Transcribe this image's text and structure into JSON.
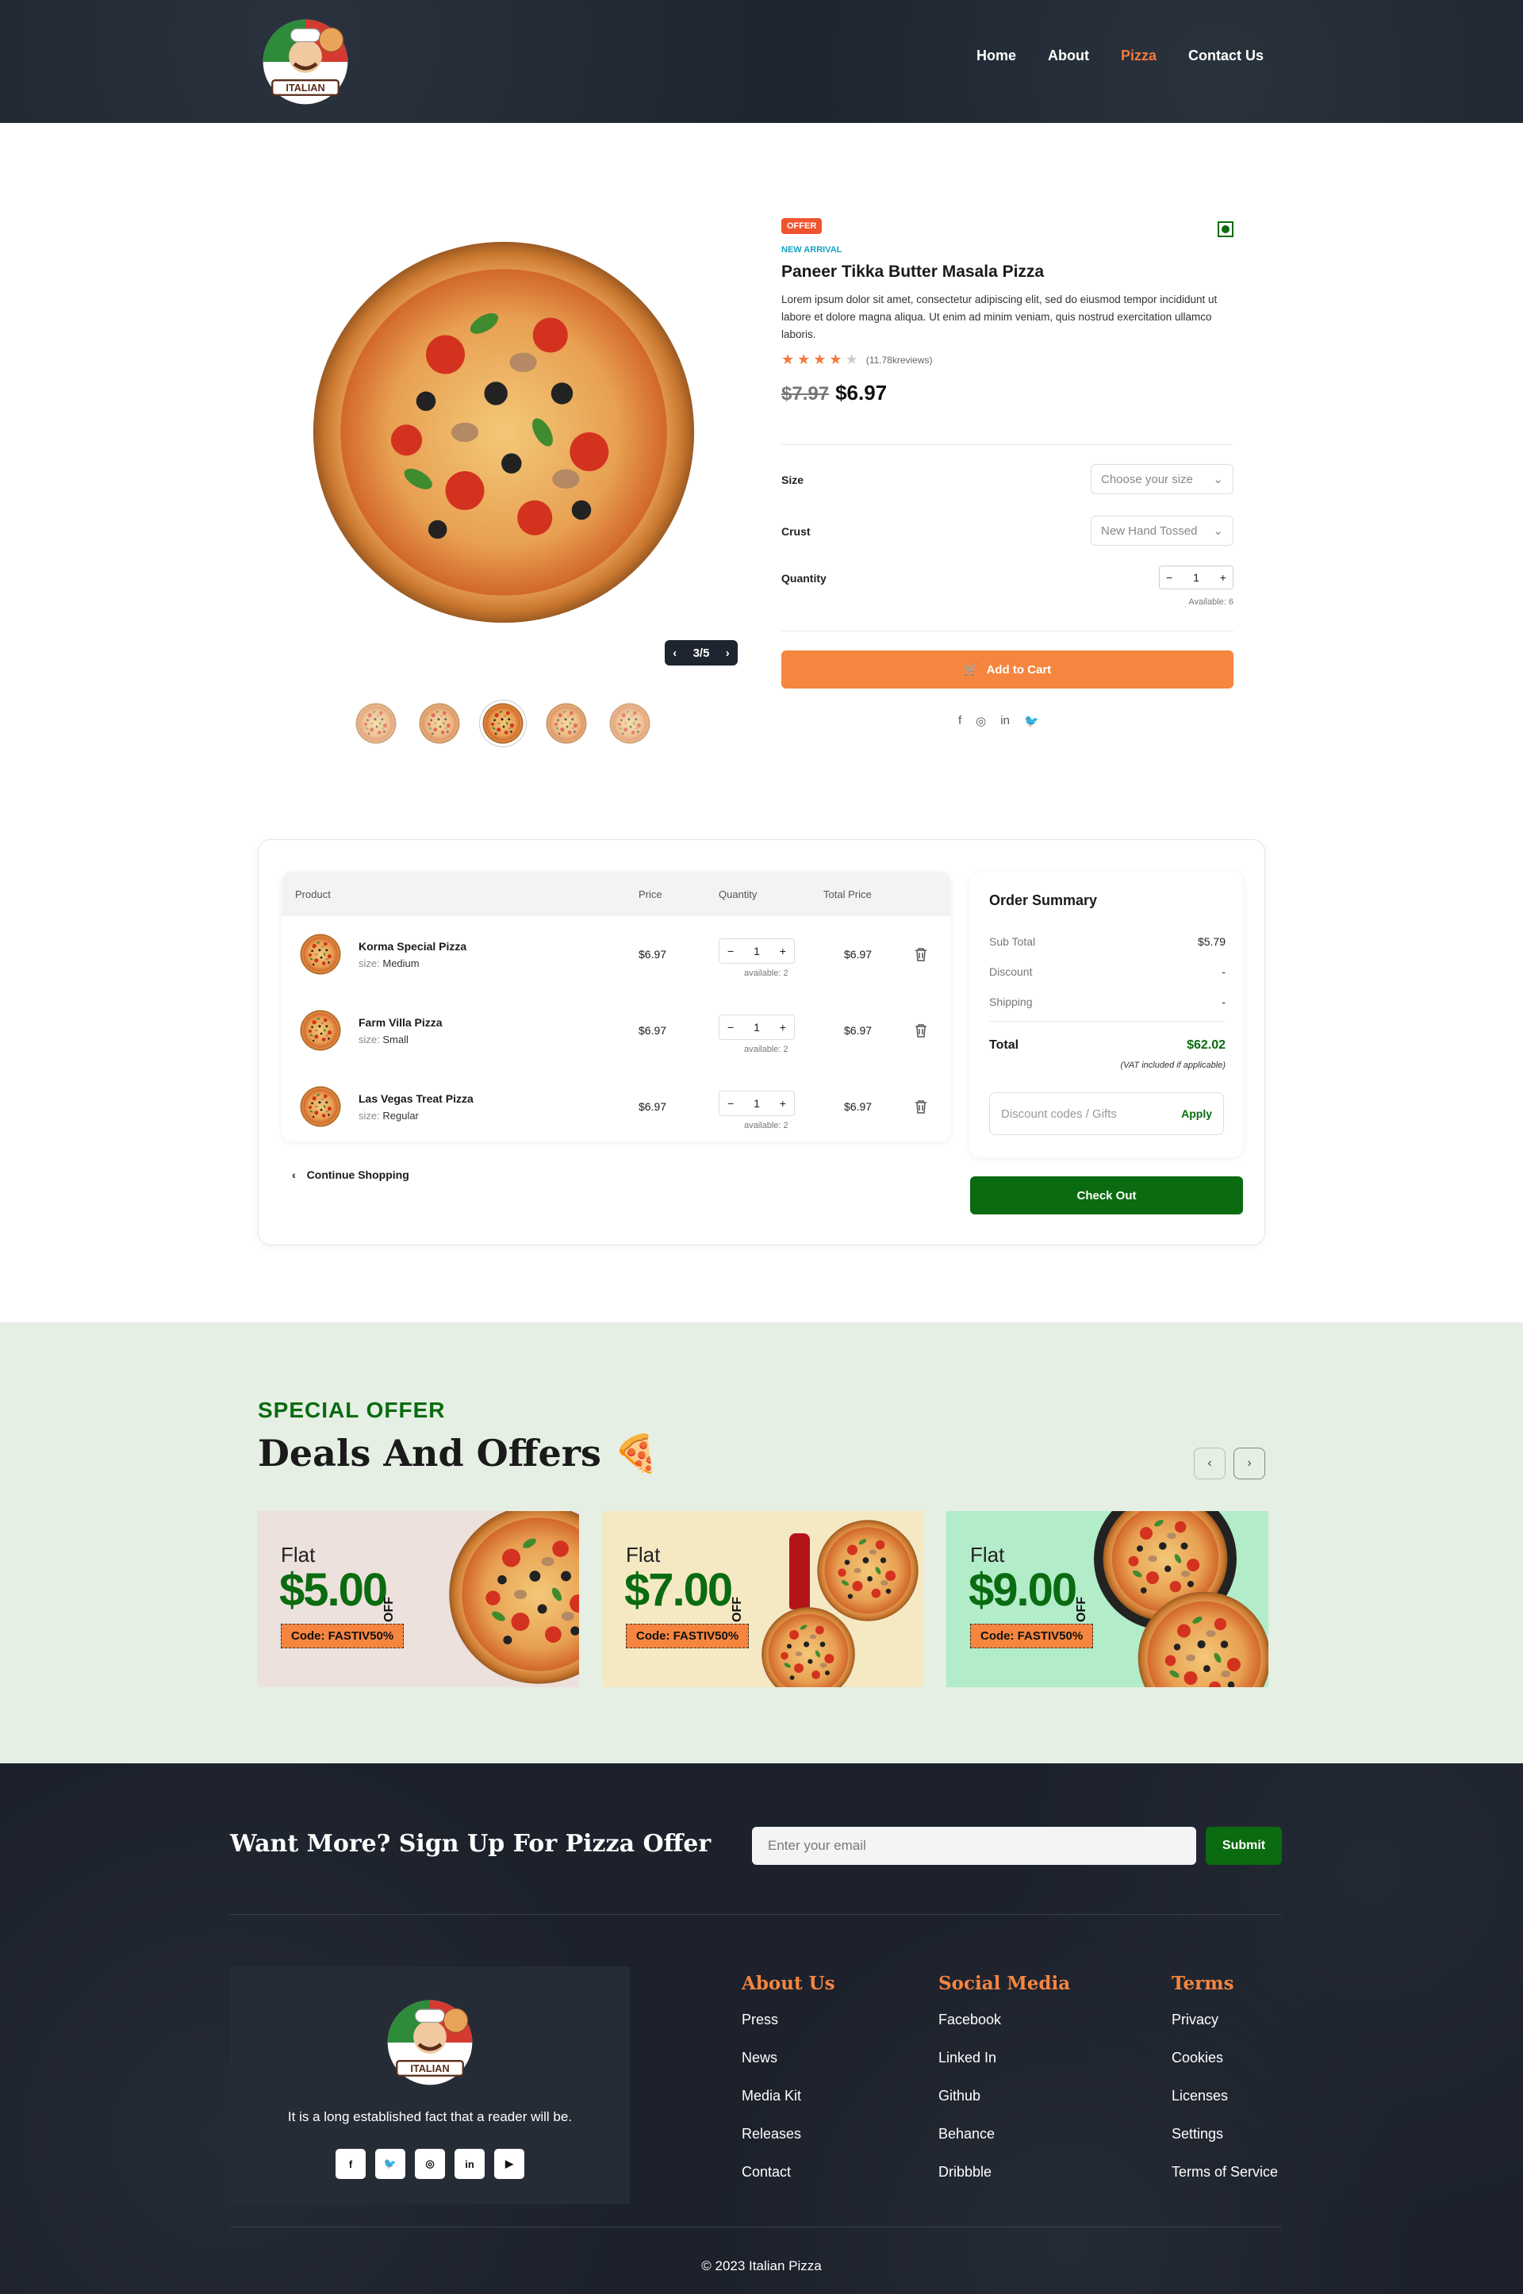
{
  "header": {
    "nav": [
      {
        "label": "Home",
        "active": false
      },
      {
        "label": "About",
        "active": false
      },
      {
        "label": "Pizza",
        "active": true
      },
      {
        "label": "Contact Us",
        "active": false
      }
    ],
    "logo_text": "ITALIAN PIZZA"
  },
  "product": {
    "badge": "OFFER",
    "tag": "NEW ARRIVAL",
    "title": "Paneer Tikka Butter Masala Pizza",
    "description": "Lorem ipsum dolor sit amet, consectetur adipiscing elit, sed do eiusmod tempor incididunt ut labore et dolore magna aliqua. Ut enim ad minim veniam, quis nostrud exercitation ullamco laboris.",
    "rating": 4,
    "rating_max": 5,
    "reviews": "(11.78kreviews)",
    "old_price": "$7.97",
    "price": "$6.97",
    "size_label": "Size",
    "size_placeholder": "Choose your size",
    "crust_label": "Crust",
    "crust_value": "New Hand Tossed",
    "quantity_label": "Quantity",
    "quantity": "1",
    "available": "Available: 6",
    "add_to_cart": "Add to Cart",
    "slider_counter": "3/5",
    "icon_names": [
      "facebook-icon",
      "instagram-icon",
      "linkedin-icon",
      "twitter-icon"
    ]
  },
  "cart": {
    "headers": {
      "product": "Product",
      "price": "Price",
      "quantity": "Quantity",
      "total": "Total Price"
    },
    "rows": [
      {
        "name": "Korma Special Pizza",
        "size_label": "size:",
        "size": "Medium",
        "price": "$6.97",
        "qty": "1",
        "available": "available: 2",
        "total": "$6.97"
      },
      {
        "name": "Farm Villa Pizza",
        "size_label": "size:",
        "size": "Small",
        "price": "$6.97",
        "qty": "1",
        "available": "available: 2",
        "total": "$6.97"
      },
      {
        "name": "Las Vegas Treat Pizza",
        "size_label": "size:",
        "size": "Regular",
        "price": "$6.97",
        "qty": "1",
        "available": "available: 2",
        "total": "$6.97"
      }
    ],
    "continue": "Continue Shopping",
    "summary": {
      "title": "Order Summary",
      "subtotal_label": "Sub Total",
      "subtotal": "$5.79",
      "discount_label": "Discount",
      "discount": "-",
      "shipping_label": "Shipping",
      "shipping": "-",
      "total_label": "Total",
      "total": "$62.02",
      "vat": "(VAT included if applicable)",
      "discount_placeholder": "Discount codes / Gifts",
      "apply": "Apply"
    },
    "checkout": "Check Out"
  },
  "offers": {
    "kicker": "SPECIAL OFFER",
    "title": "Deals And Offers",
    "cards": [
      {
        "flat": "Flat",
        "amount": "$5.00",
        "off": "OFF",
        "code": "Code: FASTIV50%",
        "bg": "#ece1dc"
      },
      {
        "flat": "Flat",
        "amount": "$7.00",
        "off": "OFF",
        "code": "Code: FASTIV50%",
        "bg": "#f5e9c4"
      },
      {
        "flat": "Flat",
        "amount": "$9.00",
        "off": "OFF",
        "code": "Code: FASTIV50%",
        "bg": "#b3ecc9"
      }
    ]
  },
  "footer": {
    "signup_title": "Want More? Sign Up For Pizza Offer",
    "email_placeholder": "Enter your email",
    "submit": "Submit",
    "tagline": "It is a long established fact that a reader will be.",
    "columns": [
      {
        "title": "About Us",
        "links": [
          "Press",
          "News",
          "Media Kit",
          "Releases",
          "Contact"
        ]
      },
      {
        "title": "Social Media",
        "links": [
          "Facebook",
          "Linked In",
          "Github",
          "Behance",
          "Dribbble"
        ]
      },
      {
        "title": "Terms",
        "links": [
          "Privacy",
          "Cookies",
          "Licenses",
          "Settings",
          "Terms of Service"
        ]
      }
    ],
    "copyright": "© 2023 Italian Pizza"
  },
  "colors": {
    "accent": "#f5853f",
    "green": "#0a6b10",
    "dark": "#1e2530"
  }
}
